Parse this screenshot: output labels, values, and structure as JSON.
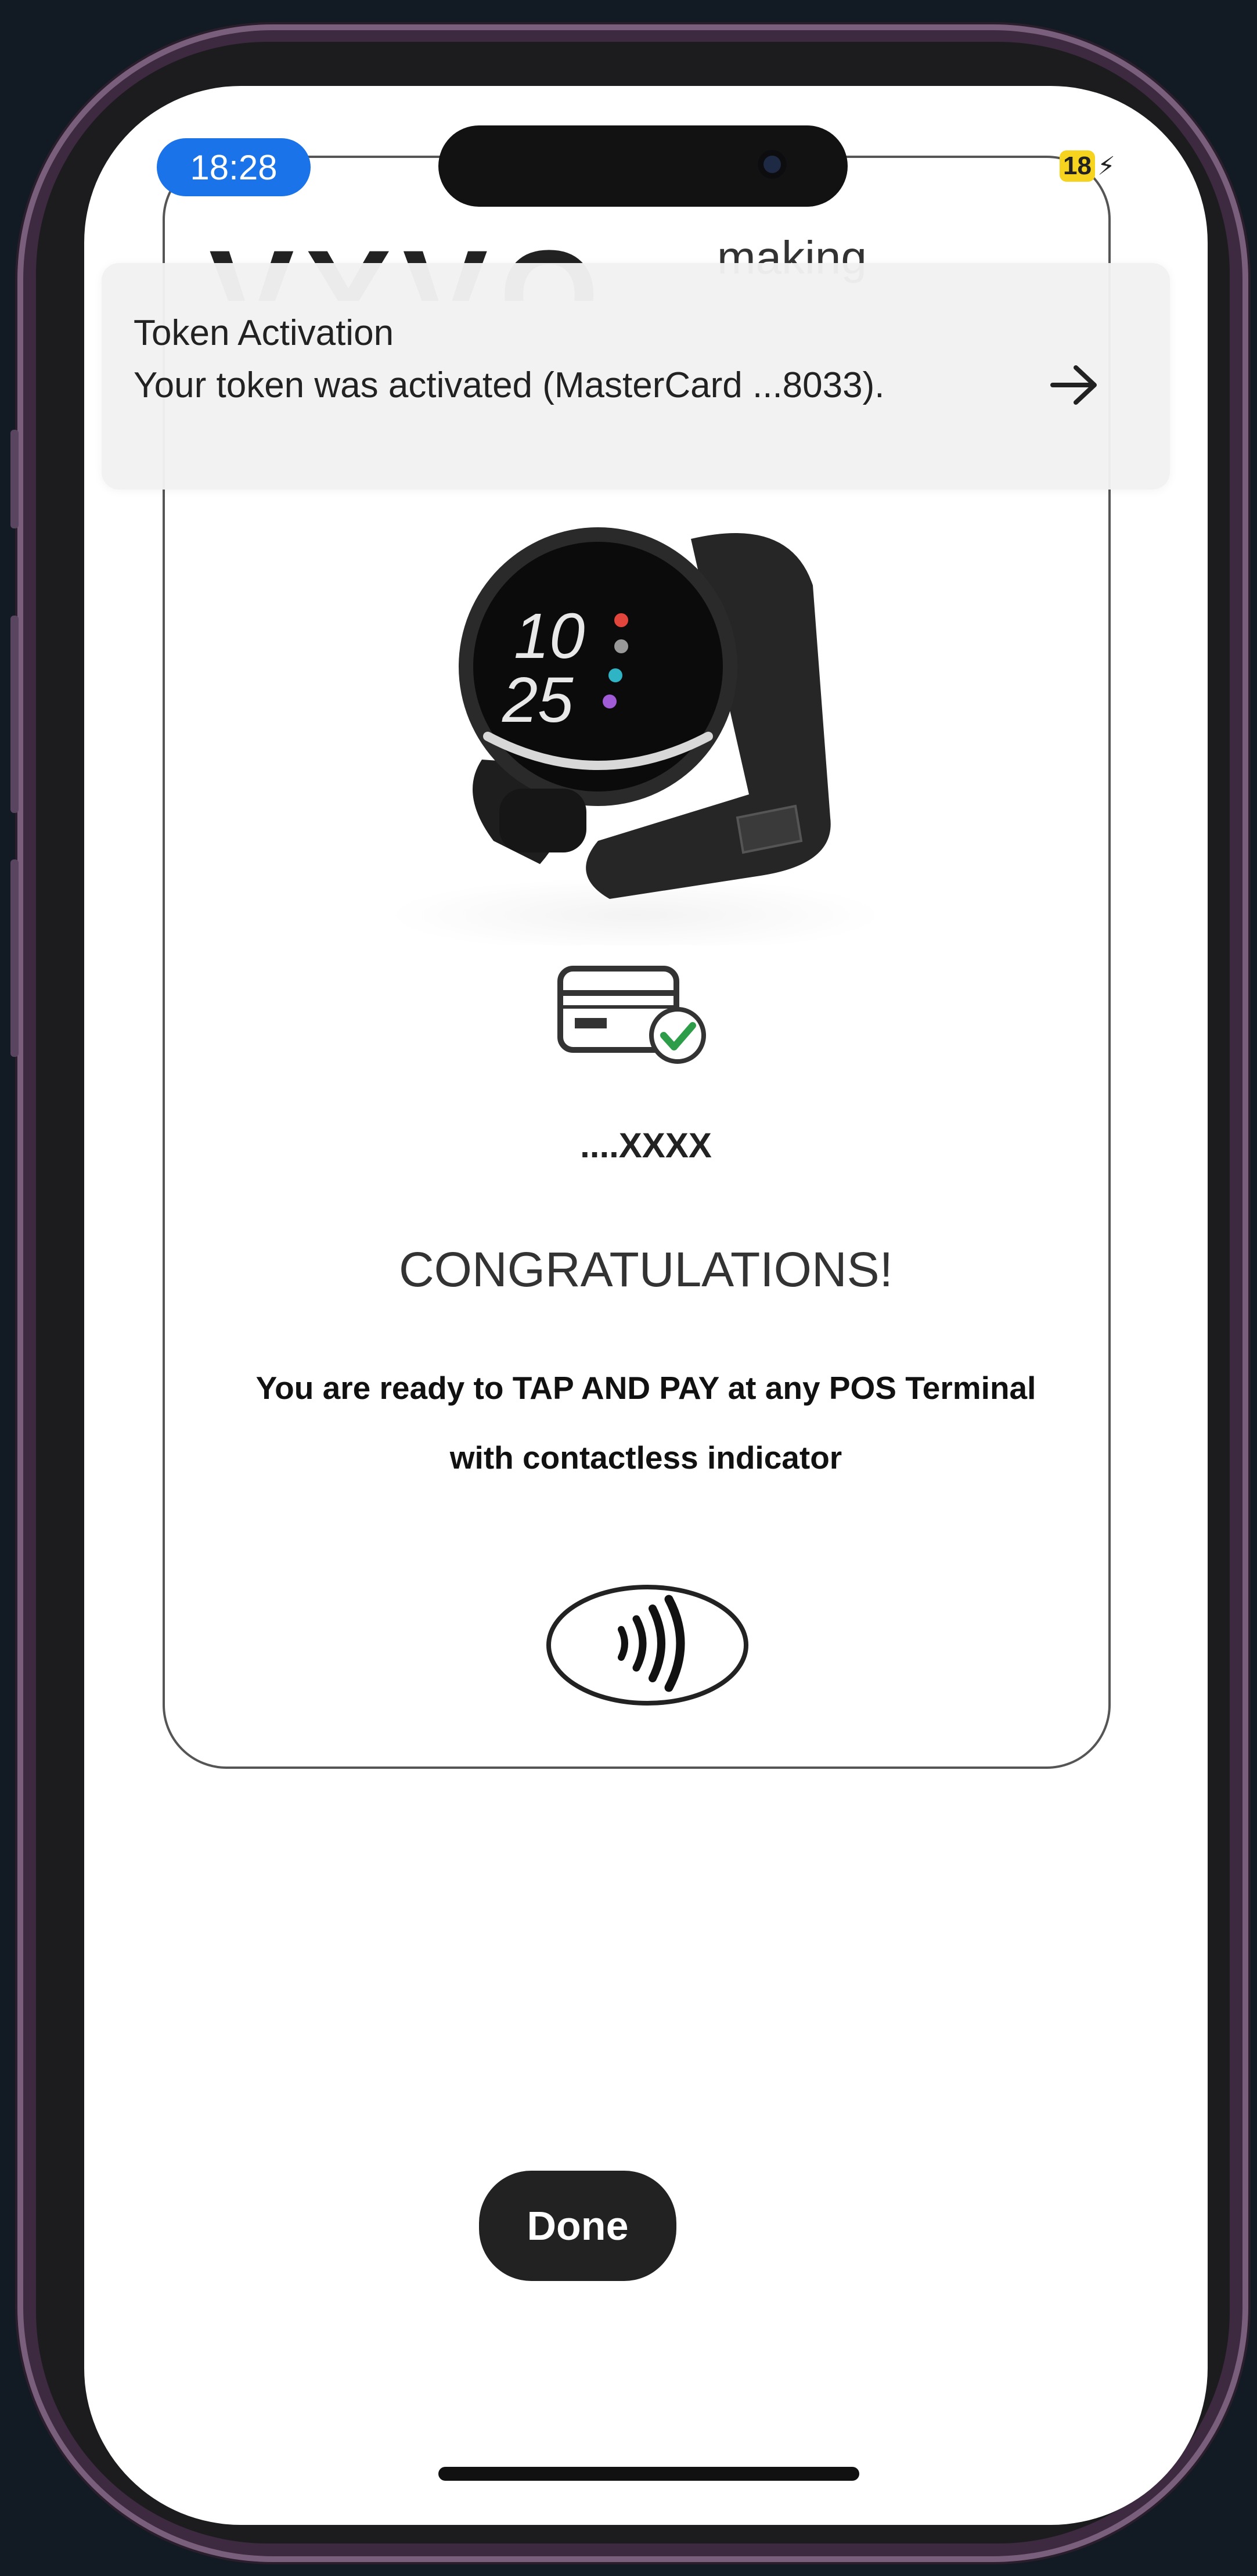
{
  "status_bar": {
    "time": "18:28",
    "battery": "18"
  },
  "brand": {
    "logo": "VYVO",
    "tagline": "making"
  },
  "notification": {
    "title": "Token Activation",
    "body": "Your token was activated (MasterCard ...8033).",
    "action_icon": "arrow-right-icon"
  },
  "watch": {
    "hour": "10",
    "minute": "25"
  },
  "card": {
    "icon": "card-check-icon",
    "masked_number": "....XXXX"
  },
  "message": {
    "heading": "CONGRATULATIONS!",
    "line1": "You are ready to TAP AND PAY at any POS Terminal",
    "line2": "with contactless indicator"
  },
  "contactless_icon": "contactless-icon",
  "done_label": "Done",
  "colors": {
    "time_pill": "#1a73e8",
    "battery": "#f5d31e",
    "check": "#2e9d4a",
    "button": "#222222"
  }
}
